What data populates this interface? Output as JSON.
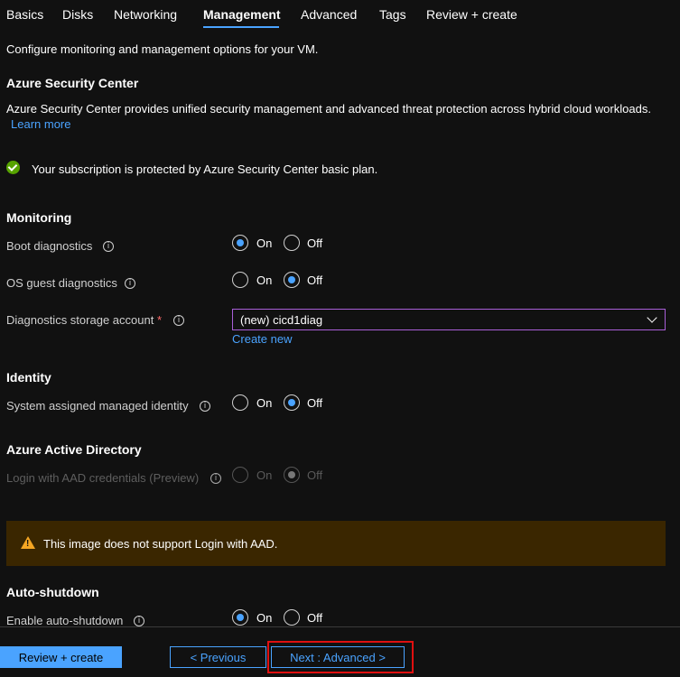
{
  "tabs": [
    {
      "label": "Basics"
    },
    {
      "label": "Disks"
    },
    {
      "label": "Networking"
    },
    {
      "label": "Management",
      "active": true
    },
    {
      "label": "Advanced"
    },
    {
      "label": "Tags"
    },
    {
      "label": "Review + create"
    }
  ],
  "intro": "Configure monitoring and management options for your VM.",
  "security": {
    "heading": "Azure Security Center",
    "description": "Azure Security Center provides unified security management and advanced threat protection across hybrid cloud workloads.",
    "learn_more": "Learn more",
    "status": "Your subscription is protected by Azure Security Center basic plan."
  },
  "monitoring": {
    "heading": "Monitoring",
    "boot_diagnostics": {
      "label": "Boot diagnostics",
      "selected": "On"
    },
    "os_guest_diagnostics": {
      "label": "OS guest diagnostics",
      "selected": "Off"
    },
    "storage_account": {
      "label": "Diagnostics storage account",
      "required": "*",
      "value": "(new) cicd1diag",
      "create_new": "Create new"
    }
  },
  "identity": {
    "heading": "Identity",
    "system_assigned": {
      "label": "System assigned managed identity",
      "selected": "Off"
    }
  },
  "aad": {
    "heading": "Azure Active Directory",
    "login": {
      "label": "Login with AAD credentials (Preview)",
      "selected": "Off",
      "disabled": true
    },
    "warning": "This image does not support Login with AAD."
  },
  "auto_shutdown": {
    "heading": "Auto-shutdown",
    "enable": {
      "label": "Enable auto-shutdown",
      "selected": "On"
    }
  },
  "options": {
    "on": "On",
    "off": "Off"
  },
  "info_glyph": "i",
  "footer": {
    "review_create": "Review + create",
    "previous": "< Previous",
    "next": "Next : Advanced >"
  },
  "colors": {
    "accent": "#4aa3ff",
    "success": "#57a300",
    "warning": "#f5a623",
    "highlight": "#e01010"
  }
}
